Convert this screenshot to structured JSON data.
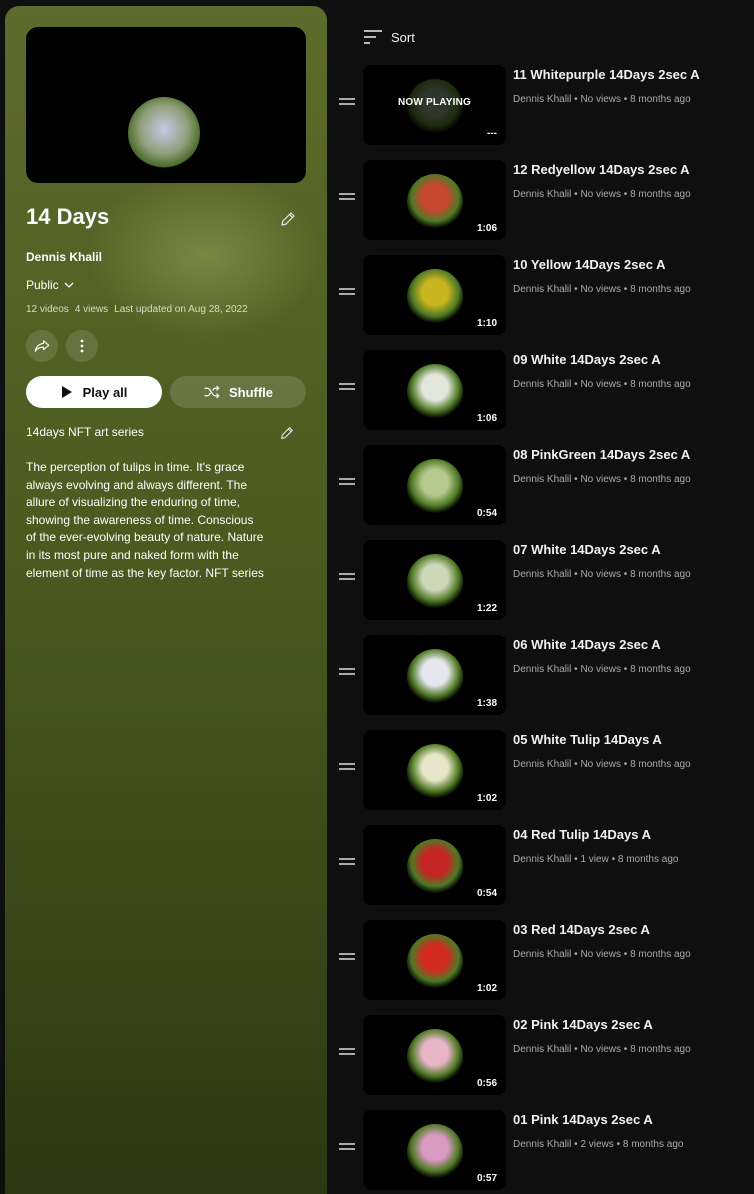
{
  "playlist": {
    "title": "14 Days",
    "owner": "Dennis Khalil",
    "privacy": "Public",
    "video_count": "12 videos",
    "views": "4 views",
    "last_updated": "Last updated on Aug 28, 2022",
    "play_all_label": "Play all",
    "shuffle_label": "Shuffle",
    "series_title": "14days NFT art series",
    "description": "The perception of tulips in time. It's grace always evolving and always different. The allure of visualizing the enduring of time, showing the awareness of time. Conscious of the ever-evolving beauty of nature. Nature in its most pure and naked form with the element of time as the key factor. NFT series"
  },
  "sort_label": "Sort",
  "now_playing_label": "NOW PLAYING",
  "videos": [
    {
      "title": "11 Whitepurple 14Days 2sec A",
      "channel": "Dennis Khalil",
      "views": "No views",
      "age": "8 months ago",
      "duration": "---",
      "now_playing": true,
      "color": "#8a9a7a"
    },
    {
      "title": "12 Redyellow 14Days 2sec A",
      "channel": "Dennis Khalil",
      "views": "No views",
      "age": "8 months ago",
      "duration": "1:06",
      "color": "#c8472f"
    },
    {
      "title": "10 Yellow 14Days 2sec A",
      "channel": "Dennis Khalil",
      "views": "No views",
      "age": "8 months ago",
      "duration": "1:10",
      "color": "#c9b51f"
    },
    {
      "title": "09 White 14Days 2sec A",
      "channel": "Dennis Khalil",
      "views": "No views",
      "age": "8 months ago",
      "duration": "1:06",
      "color": "#e3e6dc"
    },
    {
      "title": "08 PinkGreen 14Days 2sec A",
      "channel": "Dennis Khalil",
      "views": "No views",
      "age": "8 months ago",
      "duration": "0:54",
      "color": "#b7c98e"
    },
    {
      "title": "07 White 14Days 2sec A",
      "channel": "Dennis Khalil",
      "views": "No views",
      "age": "8 months ago",
      "duration": "1:22",
      "color": "#cfd7b9"
    },
    {
      "title": "06 White 14Days 2sec A",
      "channel": "Dennis Khalil",
      "views": "No views",
      "age": "8 months ago",
      "duration": "1:38",
      "color": "#e6e6ee"
    },
    {
      "title": "05 White Tulip 14Days A",
      "channel": "Dennis Khalil",
      "views": "No views",
      "age": "8 months ago",
      "duration": "1:02",
      "color": "#e8e6c8"
    },
    {
      "title": "04 Red Tulip 14Days A",
      "channel": "Dennis Khalil",
      "views": "1 view",
      "age": "8 months ago",
      "duration": "0:54",
      "color": "#c42424"
    },
    {
      "title": "03 Red 14Days 2sec A",
      "channel": "Dennis Khalil",
      "views": "No views",
      "age": "8 months ago",
      "duration": "1:02",
      "color": "#d22a1f"
    },
    {
      "title": "02 Pink 14Days 2sec A",
      "channel": "Dennis Khalil",
      "views": "No views",
      "age": "8 months ago",
      "duration": "0:56",
      "color": "#e8b5c7"
    },
    {
      "title": "01 Pink 14Days 2sec A",
      "channel": "Dennis Khalil",
      "views": "2 views",
      "age": "8 months ago",
      "duration": "0:57",
      "color": "#d89ac0"
    }
  ]
}
